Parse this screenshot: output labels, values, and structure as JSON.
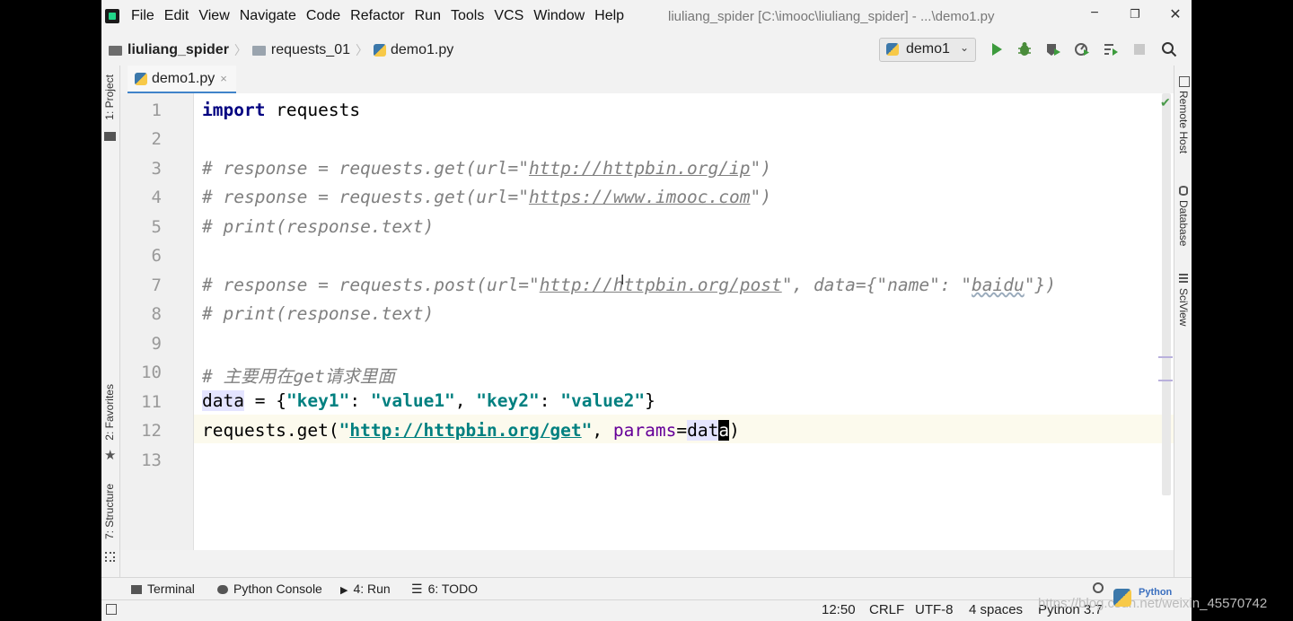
{
  "app": {
    "menu": [
      "File",
      "Edit",
      "View",
      "Navigate",
      "Code",
      "Refactor",
      "Run",
      "Tools",
      "VCS",
      "Window",
      "Help"
    ],
    "window_title": "liuliang_spider [C:\\imooc\\liuliang_spider] - ...\\demo1.py",
    "controls": {
      "minimize": "−",
      "restore": "❐",
      "close": "✕"
    }
  },
  "breadcrumb": {
    "project": "liuliang_spider",
    "folder": "requests_01",
    "file": "demo1.py"
  },
  "run_config": {
    "label": "demo1",
    "chevron": "⌄"
  },
  "toolbar_icons": [
    "run-icon",
    "debug-icon",
    "coverage-icon",
    "profile-icon",
    "concurrency-icon",
    "stop-icon",
    "search-icon"
  ],
  "left_strip": {
    "project": "1: Project",
    "favorites": "2: Favorites",
    "structure": "7: Structure"
  },
  "right_strip": {
    "remote_host": "Remote Host",
    "database": "Database",
    "sciview": "SciView"
  },
  "editor": {
    "tab": {
      "label": "demo1.py",
      "close": "×"
    },
    "line_numbers": [
      "1",
      "2",
      "3",
      "4",
      "5",
      "6",
      "7",
      "8",
      "9",
      "10",
      "11",
      "12",
      "13"
    ],
    "lines": {
      "l1": {
        "kw": "import",
        "rest": " requests"
      },
      "l3": {
        "a": "# response = requests.get(url=\"",
        "url": "http://httpbin.org/ip",
        "b": "\")"
      },
      "l4": {
        "a": "# response = requests.get(url=\"",
        "url": "https://www.imooc.com",
        "b": "\")"
      },
      "l5": {
        "text": "# print(response.text)"
      },
      "l7": {
        "a": "# response = requests.post(url=\"",
        "url": "http://httpbin.org/post",
        "b": "\", data={\"name\": \"",
        "c": "baidu",
        "d": "\"})"
      },
      "l8": {
        "text": "# print(response.text)"
      },
      "l10": {
        "text": "# 主要用在get请求里面"
      },
      "l11": {
        "var": "data",
        "eq": " = {",
        "s1": "\"key1\"",
        "c1": ": ",
        "s2": "\"value1\"",
        "c2": ", ",
        "s3": "\"key2\"",
        "c3": ": ",
        "s4": "\"value2\"",
        "end": "}"
      },
      "l12": {
        "a": "requests.get(",
        "q1": "\"",
        "url": "http://httpbin.org/get",
        "q2": "\"",
        "comma": ", ",
        "param": "params",
        "eq": "=",
        "var1": "dat",
        "caret": "a",
        "end": ")"
      }
    },
    "current_line": "12"
  },
  "toolwindows": {
    "terminal": "Terminal",
    "python_console": "Python Console",
    "run": "4: Run",
    "todo": "6: TODO"
  },
  "status": {
    "position": "12:50",
    "line_sep": "CRLF",
    "encoding": "UTF-8",
    "indent": "4 spaces",
    "interpreter": "Python 3.7"
  },
  "watermark": {
    "text": "https://blog.csdn.net/weixin_45570742",
    "badge": "Python"
  }
}
